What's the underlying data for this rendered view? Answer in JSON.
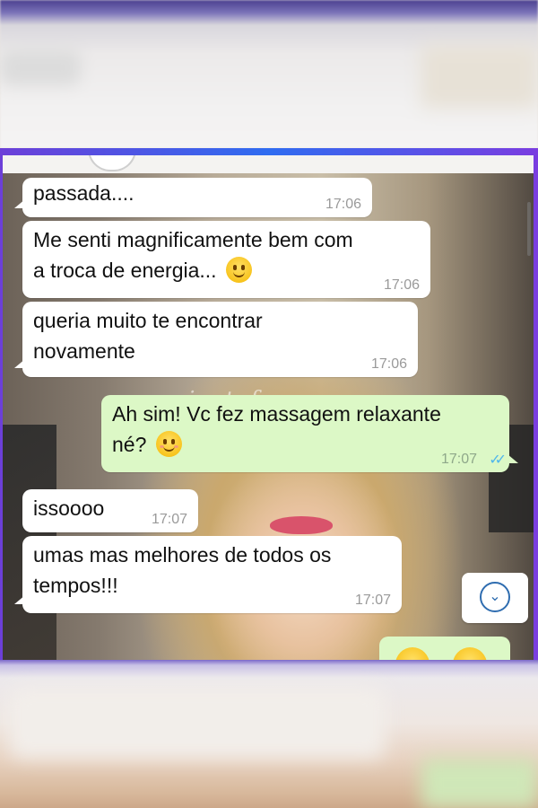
{
  "watermark": "privatefun",
  "messages": [
    {
      "direction": "incoming",
      "text": "passada....",
      "time": "17:06"
    },
    {
      "direction": "incoming",
      "line1": "Me senti magnificamente bem com",
      "line2": "a troca de energia...",
      "emoji": "slightly-smiling-face",
      "time": "17:06"
    },
    {
      "direction": "incoming",
      "line1": "queria muito te encontrar",
      "line2": "novamente",
      "time": "17:06"
    },
    {
      "direction": "outgoing",
      "line1": "Ah sim! Vc fez massagem relaxante",
      "line2": "né?",
      "emoji": "smiling-face-with-smiling-eyes",
      "time": "17:07",
      "status": "read"
    },
    {
      "direction": "incoming",
      "text": "issoooo",
      "time": "17:07"
    },
    {
      "direction": "incoming",
      "line1": "umas mas melhores de todos os",
      "line2": "tempos!!!",
      "time": "17:07"
    }
  ],
  "colors": {
    "incoming_bubble": "#ffffff",
    "outgoing_bubble": "#dcf8c6",
    "read_ticks": "#4fb6ec",
    "scroll_button_icon": "#2f6db0"
  },
  "icons": {
    "read_receipt": "✓✓",
    "scroll_down": "⌄"
  }
}
